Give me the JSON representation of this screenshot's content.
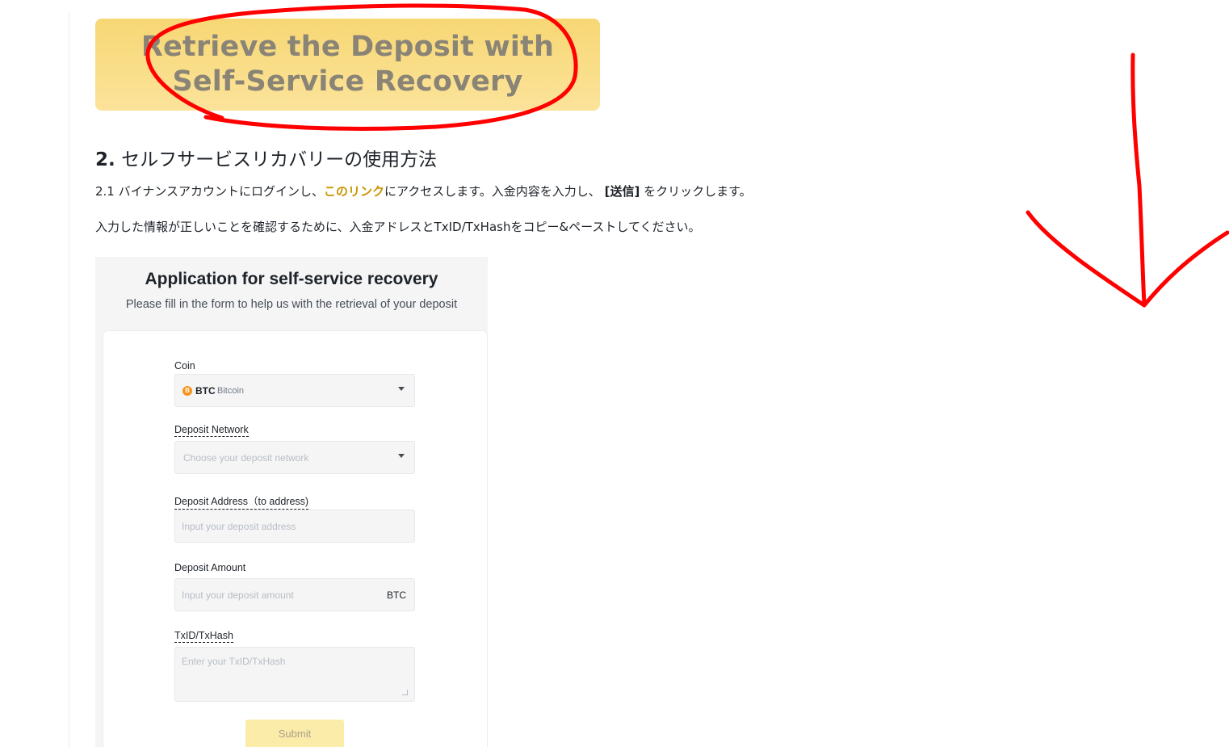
{
  "banner": {
    "line1": "Retrieve the Deposit with",
    "line2": "Self-Service Recovery"
  },
  "section": {
    "number": "2.",
    "title": "セルフサービスリカバリーの使用方法"
  },
  "paragraph1": {
    "prefix": "2.1 バイナンスアカウントにログインし、",
    "link": "このリンク",
    "middle": "にアクセスします。入金内容を入力し、",
    "submit_bold": "[送信]",
    "suffix": "をクリックします。"
  },
  "paragraph2": "入力した情報が正しいことを確認するために、入金アドレスとTxID/TxHashをコピー&ペーストしてください。",
  "form": {
    "title": "Application for self-service recovery",
    "subtitle": "Please fill in the form to help us with the retrieval of your deposit",
    "coin": {
      "label": "Coin",
      "icon_glyph": "B",
      "symbol": "BTC",
      "name": "Bitcoin"
    },
    "network": {
      "label": "Deposit Network",
      "placeholder": "Choose your deposit network"
    },
    "address": {
      "label": "Deposit Address（to address)",
      "placeholder": "Input your deposit address"
    },
    "amount": {
      "label": "Deposit Amount",
      "placeholder": "Input your deposit amount",
      "unit": "BTC"
    },
    "txid": {
      "label": "TxID/TxHash",
      "placeholder": "Enter your TxID/TxHash"
    },
    "submit_label": "Submit"
  },
  "colors": {
    "brand_yellow": "#f0b90b",
    "link_gold": "#c99400",
    "annotation_red": "#ff0000"
  }
}
